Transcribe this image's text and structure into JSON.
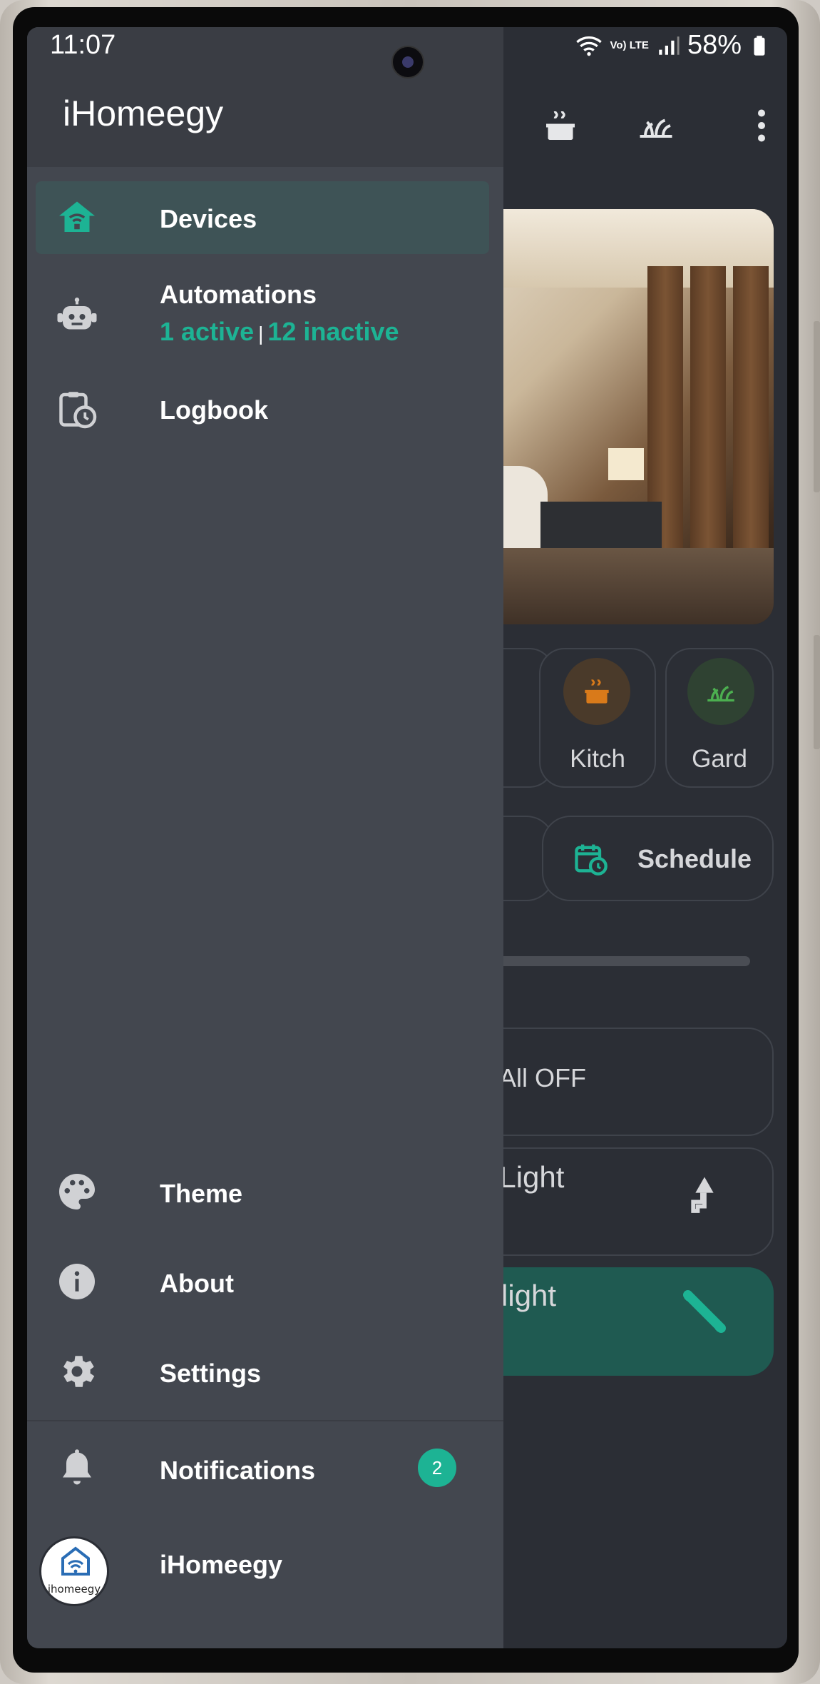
{
  "status_bar": {
    "time": "11:07",
    "network": "Vo) LTE",
    "battery": "58%"
  },
  "app": {
    "rooms": [
      {
        "label": "Kitch",
        "icon": "cooking-pot-icon",
        "color": "#d97a1a"
      },
      {
        "label": "Gard",
        "icon": "grass-icon",
        "color": "#4caf50"
      }
    ],
    "schedule_label": "Schedule",
    "all_off_label": "All OFF",
    "devices": [
      {
        "name": "ll Light",
        "icon": "floor-lamp-icon"
      },
      {
        "name": "otlight",
        "icon": "light-tube-icon"
      }
    ]
  },
  "drawer": {
    "title": "iHomeegy",
    "nav": [
      {
        "label": "Devices",
        "icon": "home-icon",
        "active": true
      },
      {
        "label": "Automations",
        "icon": "robot-icon",
        "active_text": "1 active",
        "separator": "|",
        "inactive_text": "12 inactive"
      },
      {
        "label": "Logbook",
        "icon": "clipboard-clock-icon"
      }
    ],
    "bottom_nav": [
      {
        "label": "Theme",
        "icon": "palette-icon"
      },
      {
        "label": "About",
        "icon": "info-icon"
      },
      {
        "label": "Settings",
        "icon": "gear-icon"
      }
    ],
    "notifications": {
      "label": "Notifications",
      "icon": "bell-icon",
      "count": "2"
    },
    "user": {
      "name": "iHomeegy",
      "logo_text": "ihomeegy"
    },
    "colors": {
      "accent": "#1db394",
      "drawer_bg": "#43474f",
      "active_item": "#3e5356"
    }
  }
}
